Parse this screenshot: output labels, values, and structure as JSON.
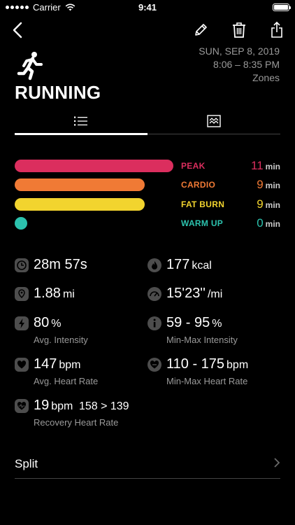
{
  "status_bar": {
    "carrier": "Carrier",
    "time": "9:41"
  },
  "header": {
    "title": "RUNNING",
    "date": "SUN, SEP 8, 2019",
    "time_range": "8:06 – 8:35 PM",
    "zones_link": "Zones"
  },
  "colors": {
    "peak": "#DB2E5E",
    "cardio": "#F07A35",
    "fat_burn": "#F2D42E",
    "warm_up": "#2CC2AE",
    "icon_bg": "#4d4d4d"
  },
  "zones": [
    {
      "label": "PEAK",
      "value": "11",
      "unit": "min",
      "fill": 1.0
    },
    {
      "label": "CARDIO",
      "value": "9",
      "unit": "min",
      "fill": 0.8182
    },
    {
      "label": "FAT BURN",
      "value": "9",
      "unit": "min",
      "fill": 0.8182
    },
    {
      "label": "WARM UP",
      "value": "0",
      "unit": "min",
      "fill": 0.0
    }
  ],
  "stats": {
    "duration": {
      "value": "28m 57s",
      "icon": "clock-icon"
    },
    "calories": {
      "value": "177",
      "unit": "kcal",
      "icon": "flame-icon"
    },
    "distance": {
      "value": "1.88",
      "unit": "mi",
      "icon": "location-pin-icon"
    },
    "pace": {
      "value": "15'23''",
      "unit": "/mi",
      "icon": "speedometer-icon"
    },
    "intensity": {
      "value": "80",
      "unit": "%",
      "sub": "Avg. Intensity",
      "icon": "bolt-icon"
    },
    "minmax_intensity": {
      "value": "59 - 95",
      "unit": "%",
      "sub": "Min-Max Intensity",
      "icon": "info-icon"
    },
    "heart_rate": {
      "value": "147",
      "unit": "bpm",
      "sub": "Avg. Heart Rate",
      "icon": "heart-icon"
    },
    "minmax_heart_rate": {
      "value": "110 - 175",
      "unit": "bpm",
      "sub": "Min-Max Heart Rate",
      "icon": "heart-range-icon"
    },
    "recovery": {
      "value": "19",
      "unit": "bpm",
      "extra": "158 > 139",
      "sub": "Recovery Heart Rate",
      "icon": "heart-recovery-icon"
    }
  },
  "split": {
    "label": "Split"
  }
}
